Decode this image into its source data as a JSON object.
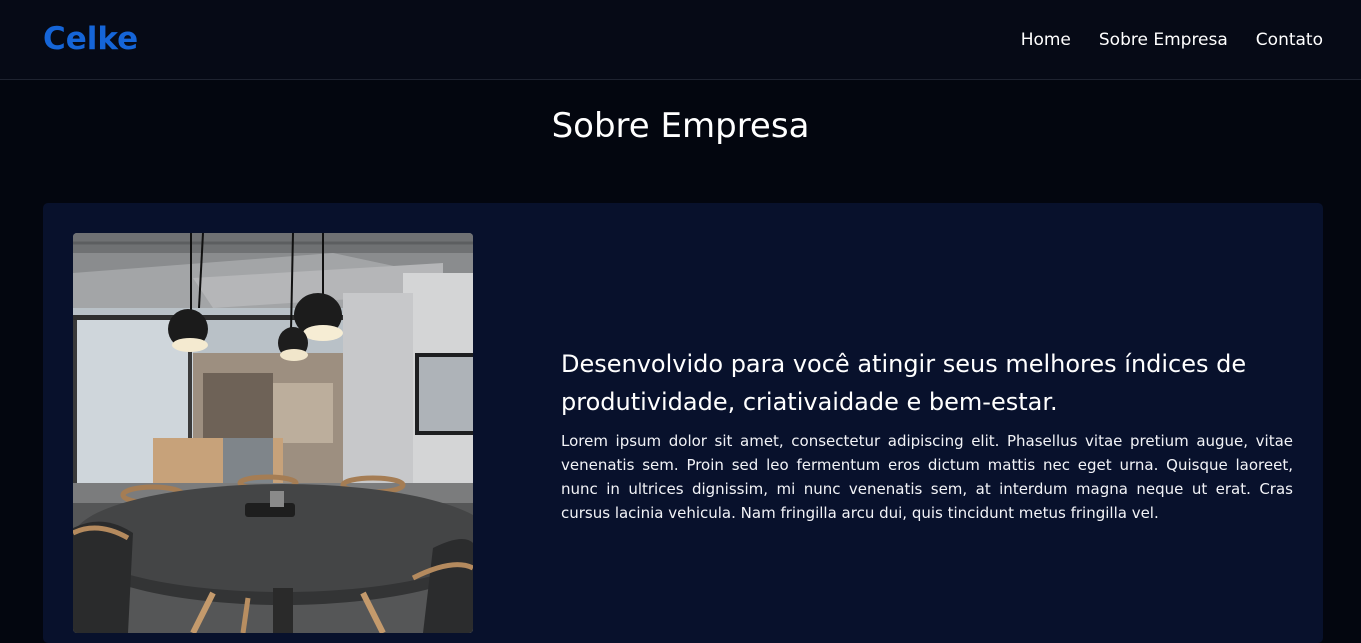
{
  "header": {
    "logo": "Celke",
    "nav": [
      {
        "label": "Home"
      },
      {
        "label": "Sobre Empresa"
      },
      {
        "label": "Contato"
      }
    ]
  },
  "about": {
    "title": "Sobre Empresa",
    "headline": "Desenvolvido para você atingir seus melhores índices de produtividade, criativaidade e bem-estar.",
    "paragraph": "Lorem ipsum dolor sit amet, consectetur adipiscing elit. Phasellus vitae pretium augue, vitae venenatis sem. Proin sed leo fermentum eros dictum mattis nec eget urna. Quisque laoreet, nunc in ultrices dignissim, mi nunc venenatis sem, at interdum magna neque ut erat. Cras cursus lacinia vehicula. Nam fringilla arcu dui, quis tincidunt metus fringilla vel.",
    "image": "meeting-room-photo"
  },
  "colors": {
    "page_bg": "#03060f",
    "navbar_bg": "#060a16",
    "brand": "#1565d8",
    "card_bg": "#08112c",
    "text": "#ffffff"
  }
}
